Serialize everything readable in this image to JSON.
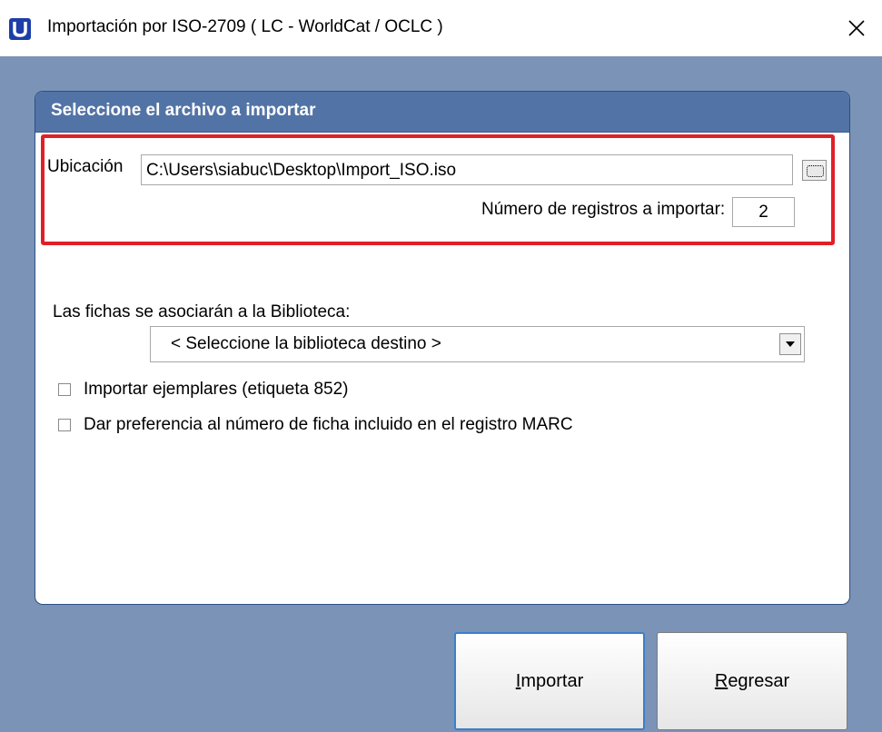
{
  "window": {
    "title": "Importación por ISO-2709  ( LC - WorldCat / OCLC )",
    "icons": {
      "app": "siabuc-app-icon",
      "close": "close-icon"
    }
  },
  "panel": {
    "title": "Seleccione el archivo a importar"
  },
  "file": {
    "location_label": "Ubicación",
    "location_value": "C:\\Users\\siabuc\\Desktop\\Import_ISO.iso",
    "browse_icon": "folder-browse-icon",
    "count_label": "Número de registros a importar:",
    "count_value": "2",
    "highlight_color": "#e02027"
  },
  "library": {
    "label": "Las fichas se asociarán a la Biblioteca:",
    "selected": "< Seleccione la biblioteca destino >"
  },
  "options": [
    {
      "label": "Importar ejemplares (etiqueta 852)",
      "checked": false
    },
    {
      "label": "Dar preferencia al número de ficha incluido en el registro MARC",
      "checked": false
    }
  ],
  "buttons": {
    "import_mnemonic": "I",
    "import_rest": "mportar",
    "back_mnemonic": "R",
    "back_rest": "egresar"
  },
  "colors": {
    "client_background": "#7a93b6",
    "panel_header": "#5273a6",
    "focus_border": "#3c7fc9"
  }
}
